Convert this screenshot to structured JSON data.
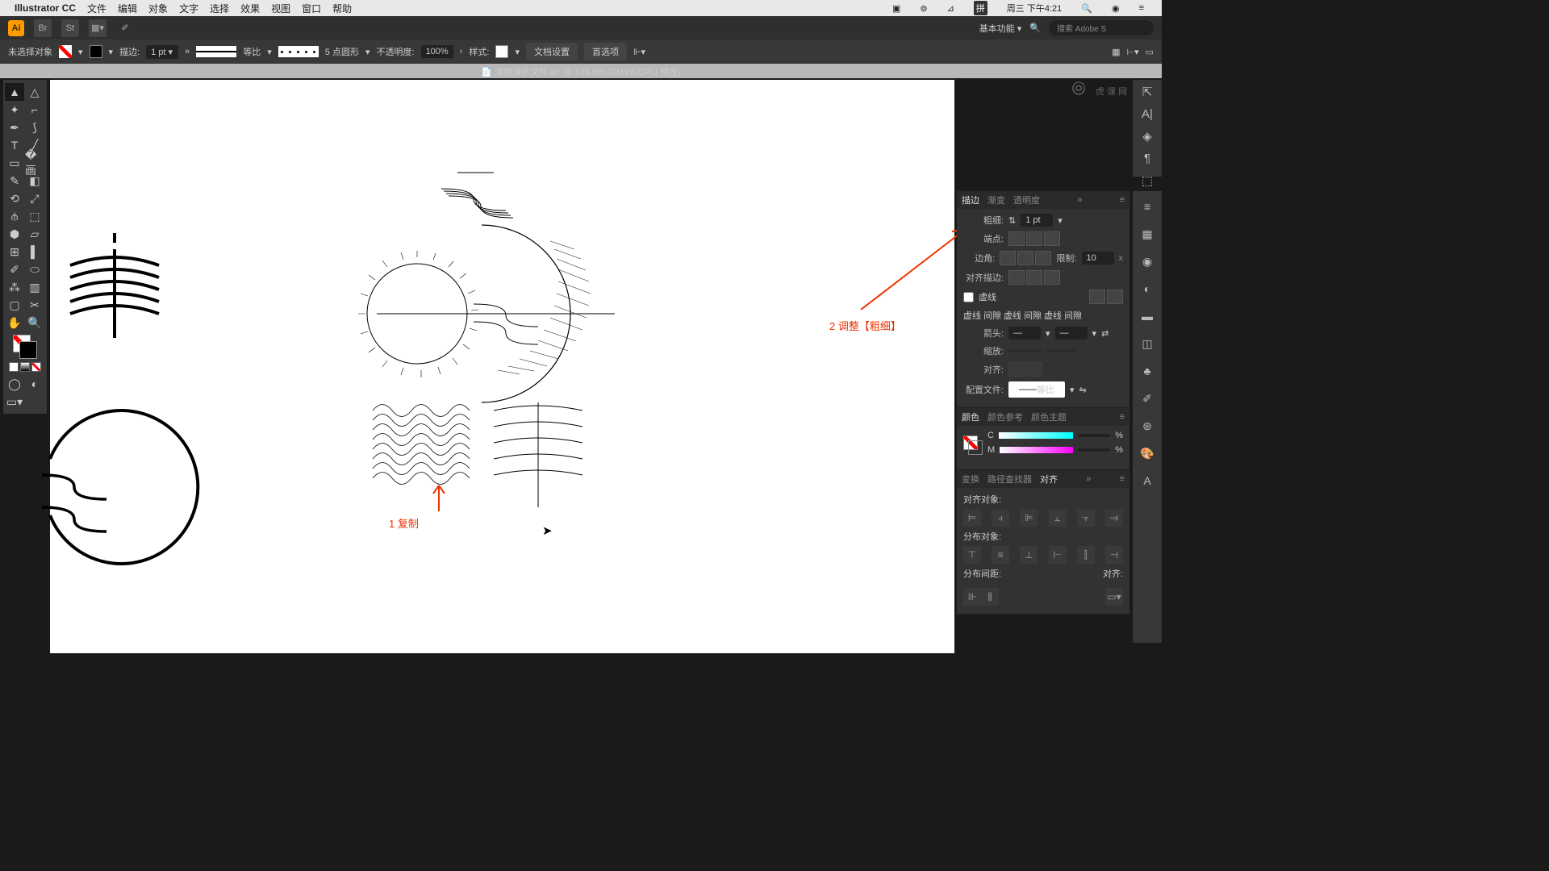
{
  "menubar": {
    "app": "Illustrator CC",
    "items": [
      "文件",
      "编辑",
      "对象",
      "文字",
      "选择",
      "效果",
      "视图",
      "窗口",
      "帮助"
    ],
    "day": "周三 下午4:21",
    "ime": "拼"
  },
  "appbar": {
    "workspace": "基本功能",
    "search": "搜索 Adobe S"
  },
  "control": {
    "selection": "未选择对象",
    "stroke_lbl": "描边:",
    "stroke_val": "1 pt",
    "profile": "等比",
    "brush": "5 点圆形",
    "opacity_lbl": "不透明度:",
    "opacity_val": "100%",
    "style_lbl": "样式:",
    "docset": "文档设置",
    "prefs": "首选项"
  },
  "doctab": "清明演示文件.ai* @ 146.8% (CMYK/GPU 预览)",
  "annotations": {
    "a1": "1 复制",
    "a2": "2 调整【粗细】"
  },
  "stroke_panel": {
    "t1": "描边",
    "t2": "渐变",
    "t3": "透明度",
    "weight": "粗细:",
    "weight_v": "1 pt",
    "cap": "端点:",
    "corner": "边角:",
    "limit": "限制:",
    "limit_v": "10",
    "align": "对齐描边:",
    "dash": "虚线",
    "d1": "虚线",
    "d2": "间隙",
    "d3": "虚线",
    "d4": "间隙",
    "d5": "虚线",
    "d6": "间隙",
    "arrow": "箭头:",
    "scale": "缩放:",
    "alignarr": "对齐:",
    "profile": "配置文件:",
    "profile_v": "等比"
  },
  "color_panel": {
    "t1": "颜色",
    "t2": "颜色参考",
    "t3": "颜色主题",
    "c": "C",
    "m": "M",
    "pct": "%"
  },
  "align_panel": {
    "t1": "变换",
    "t2": "路径查找器",
    "t3": "对齐",
    "alignobj": "对齐对象:",
    "distobj": "分布对象:",
    "distspace": "分布间距:",
    "alignto": "对齐:"
  },
  "watermark": "虎课网"
}
